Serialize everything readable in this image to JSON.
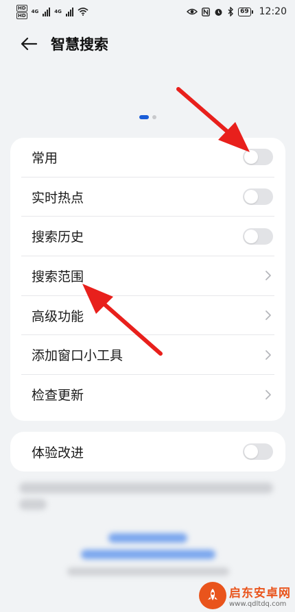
{
  "status_bar": {
    "sim1": "HD",
    "sim2": "HD",
    "net1": "4G",
    "net2": "4G",
    "battery": "69",
    "time": "12:20"
  },
  "header": {
    "title": "智慧搜索"
  },
  "pager": {
    "pages": 2,
    "current": 1
  },
  "main_settings": [
    {
      "label": "常用",
      "type": "toggle",
      "on": false
    },
    {
      "label": "实时热点",
      "type": "toggle",
      "on": false
    },
    {
      "label": "搜索历史",
      "type": "toggle",
      "on": false
    },
    {
      "label": "搜索范围",
      "type": "link"
    },
    {
      "label": "高级功能",
      "type": "link"
    },
    {
      "label": "添加窗口小工具",
      "type": "link"
    },
    {
      "label": "检查更新",
      "type": "link"
    }
  ],
  "extra_settings": [
    {
      "label": "体验改进",
      "type": "toggle",
      "on": false
    }
  ],
  "annotation_color": "#e8201c",
  "accent_color": "#1a5dd8",
  "watermark": {
    "name": "启东安卓网",
    "url": "www.qdltdq.com"
  }
}
